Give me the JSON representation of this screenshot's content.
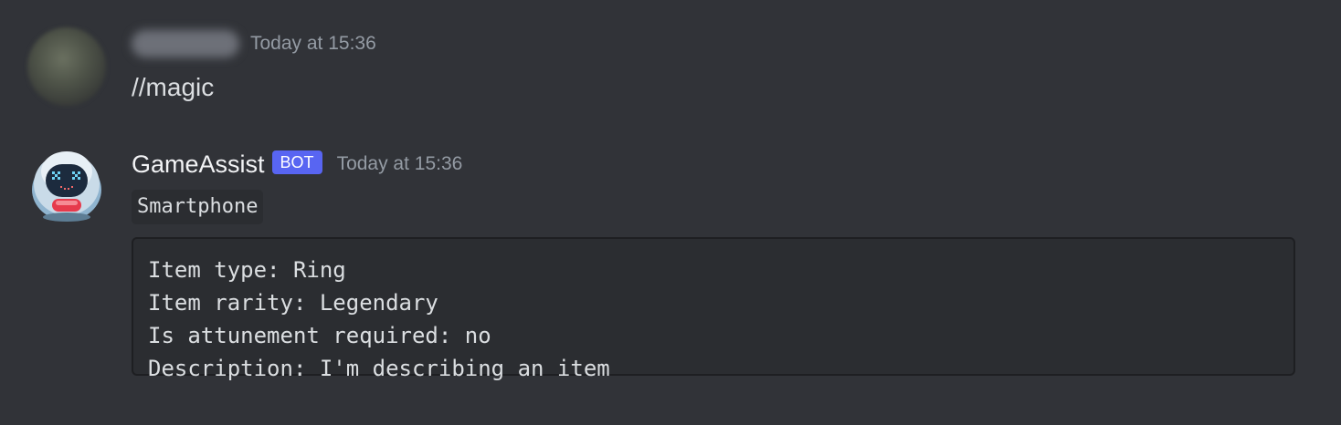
{
  "messages": [
    {
      "author": "",
      "timestamp": "Today at 15:36",
      "content": "//magic",
      "avatar_icon": "blurred-user-avatar"
    },
    {
      "author": "GameAssist",
      "badge": "BOT",
      "timestamp": "Today at 15:36",
      "inline_code": "Smartphone",
      "avatar_icon": "robot-avatar",
      "code_block": {
        "lines": [
          "Item type: Ring",
          "Item rarity: Legendary",
          "Is attunement required: no",
          "Description: I'm describing an item"
        ]
      }
    }
  ],
  "colors": {
    "background": "#313338",
    "code_background": "#2b2d31",
    "bot_badge": "#5865f2",
    "timestamp": "#949ba4",
    "text": "#dbdee1"
  }
}
